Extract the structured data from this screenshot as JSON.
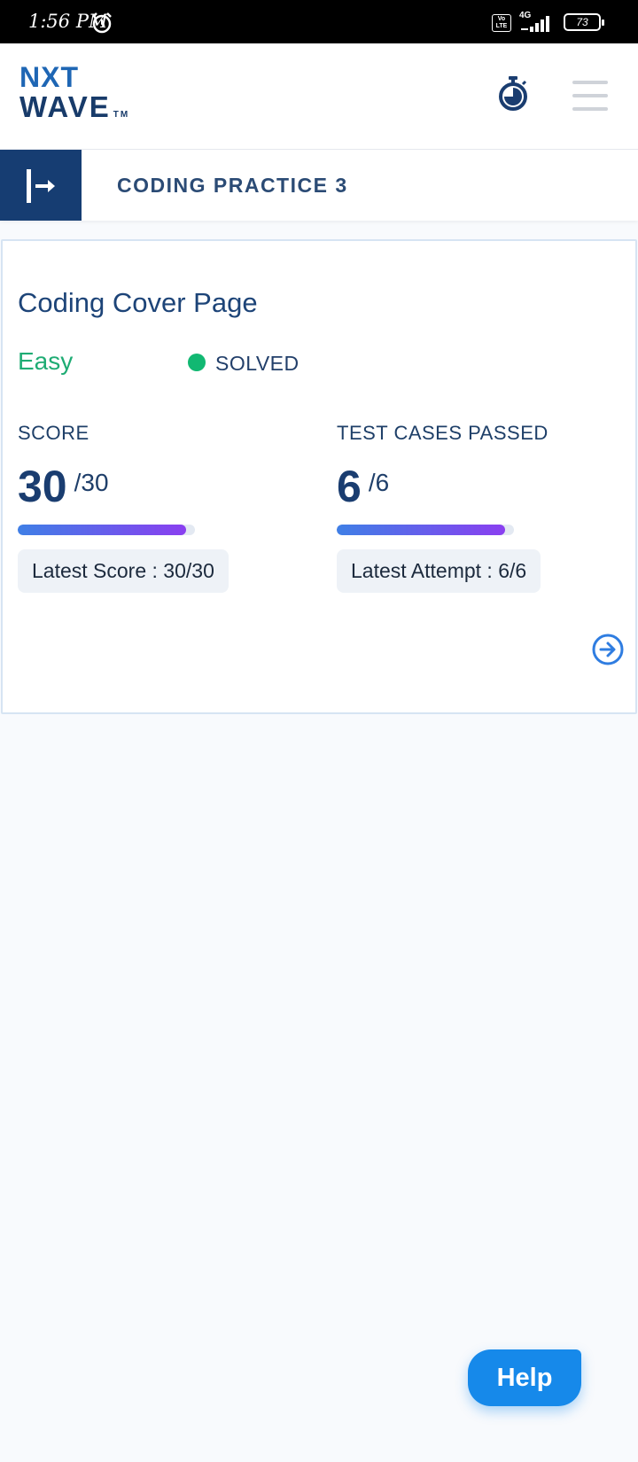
{
  "status_bar": {
    "time": "1:56 PM",
    "volte_label": "Vo LTE",
    "network": "4G",
    "battery": "73"
  },
  "header": {
    "logo_top": "NXT",
    "logo_bottom": "WAVE",
    "logo_tm": "TM",
    "icons": [
      "timer-icon",
      "menu-icon"
    ]
  },
  "sub_header": {
    "title": "CODING PRACTICE 3",
    "toggle_icon": "sidebar-expand-icon",
    "toggle_color": "#163d72"
  },
  "card": {
    "title": "Coding Cover Page",
    "difficulty": "Easy",
    "difficulty_color": "#1fac74",
    "status": "SOLVED",
    "status_color": "#11b872",
    "score": {
      "label": "SCORE",
      "value": "30",
      "total": "/30",
      "progress": 1.0,
      "latest": "Latest Score : 30/30"
    },
    "test_cases": {
      "label": "TEST CASES PASSED",
      "value": "6",
      "total": "/6",
      "progress": 1.0,
      "latest": "Latest Attempt : 6/6"
    },
    "next_icon": "arrow-right-circle-icon"
  },
  "help": {
    "label": "Help",
    "color": "#1689ea"
  }
}
